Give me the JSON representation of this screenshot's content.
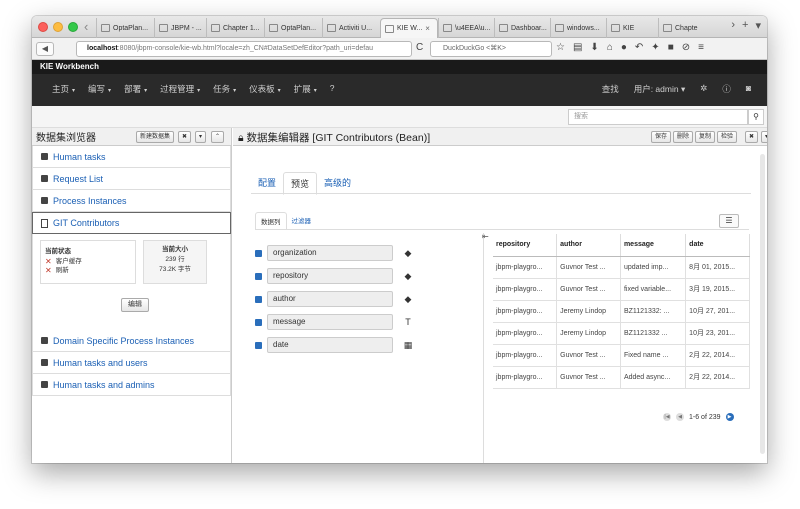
{
  "browser": {
    "tabs": [
      {
        "label": "OptaPlan..."
      },
      {
        "label": "JBPM - ..."
      },
      {
        "label": "Chapter 1..."
      },
      {
        "label": "OptaPlan..."
      },
      {
        "label": "Activiti U..."
      },
      {
        "label": "KIE W...",
        "active": true
      },
      {
        "label": "\\u4EEA\\u..."
      },
      {
        "label": "Dashboar..."
      },
      {
        "label": "windows..."
      },
      {
        "label": "KIE"
      },
      {
        "label": "Chapter"
      }
    ],
    "url_host": "localhost",
    "url_rest": ":8080/jbpm-console/kie-wb.html?locale=zh_CN#DataSetDefEditor?path_uri=defau",
    "search_placeholder": "DuckDuckGo <⌘K>"
  },
  "app": {
    "title": "KIE Workbench",
    "nav": [
      "主页",
      "编写",
      "部署",
      "过程管理",
      "任务",
      "仪表板",
      "扩展"
    ],
    "nav_right": {
      "find": "查找",
      "user": "用户: admin"
    },
    "search_placeholder": "搜索"
  },
  "left_panel": {
    "title": "数据集浏览器",
    "new_button": "新建数据集",
    "items_before": [
      "Human tasks",
      "Request List",
      "Process Instances"
    ],
    "selected": "GIT Contributors",
    "items_after": [
      "Domain Specific Process Instances",
      "Human tasks and users",
      "Human tasks and admins"
    ],
    "status": {
      "label": "当前状态",
      "items": [
        "客户缓存",
        "刷新"
      ]
    },
    "size": {
      "label": "当前大小",
      "rows": "239 行",
      "bytes": "73.2K 字节"
    },
    "edit_button": "编辑"
  },
  "editor": {
    "title": "数据集编辑器 [GIT Contributors (Bean)]",
    "header_buttons": [
      "保存",
      "删除",
      "复制",
      "检验"
    ],
    "tabs": [
      "配置",
      "预览",
      "高级的"
    ],
    "active_tab": "预览",
    "subtabs": [
      "数据列",
      "过滤器"
    ],
    "columns": [
      {
        "name": "organization",
        "type_icon": "tag-icon"
      },
      {
        "name": "repository",
        "type_icon": "tag-icon"
      },
      {
        "name": "author",
        "type_icon": "tag-icon"
      },
      {
        "name": "message",
        "type_icon": "text-type-icon"
      },
      {
        "name": "date",
        "type_icon": "calendar-icon"
      }
    ],
    "table": {
      "headers": [
        "repository",
        "author",
        "message",
        "date"
      ],
      "rows": [
        [
          "jbpm-playgro...",
          "Guvnor Test ...",
          "updated imp...",
          "8月 01, 2015..."
        ],
        [
          "jbpm-playgro...",
          "Guvnor Test ...",
          "fixed variable...",
          "3月 19, 2015..."
        ],
        [
          "jbpm-playgro...",
          "Jeremy Lindop",
          "BZ1121332: ...",
          "10月 27, 201..."
        ],
        [
          "jbpm-playgro...",
          "Jeremy Lindop",
          "BZ1121332 ...",
          "10月 23, 201..."
        ],
        [
          "jbpm-playgro...",
          "Guvnor Test ...",
          "Fixed name ...",
          "2月 22, 2014..."
        ],
        [
          "jbpm-playgro...",
          "Guvnor Test ...",
          "Added async...",
          "2月 22, 2014..."
        ]
      ]
    },
    "pager": "1-6 of 239"
  }
}
